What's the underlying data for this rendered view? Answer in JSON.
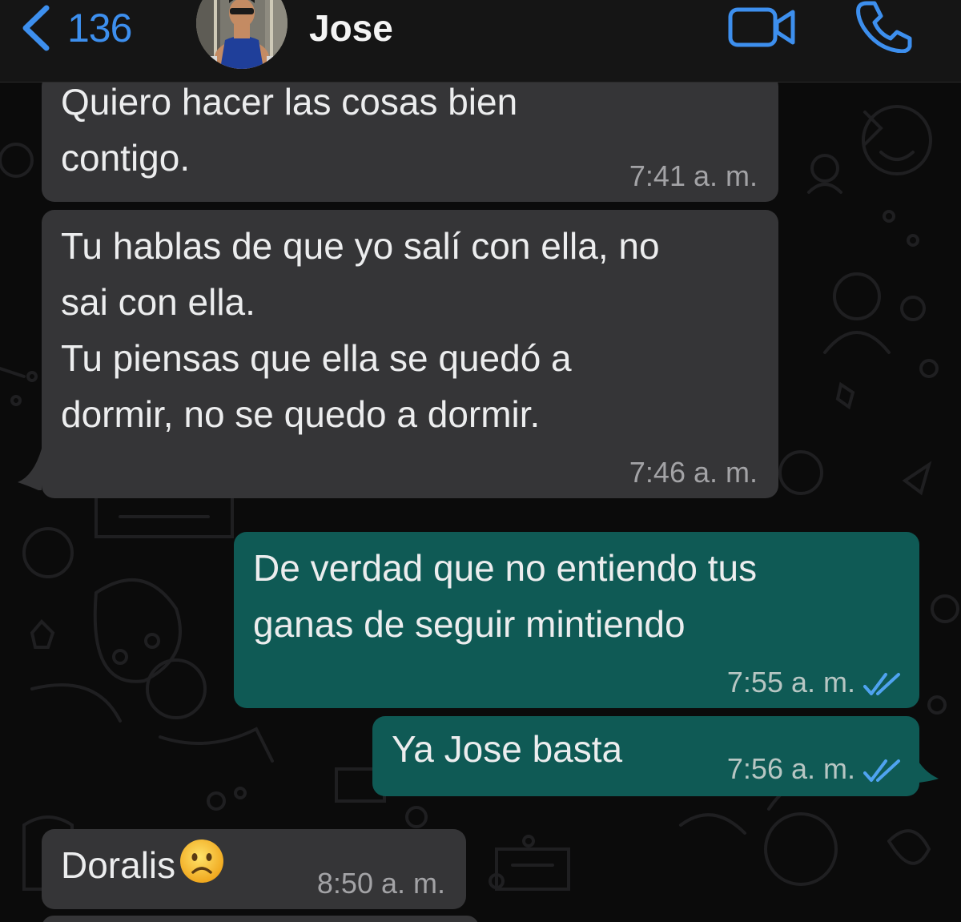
{
  "header": {
    "back_count": "136",
    "contact_name": "Jose",
    "icons": {
      "back": "chevron-left-icon",
      "video": "video-camera-icon",
      "call": "phone-icon"
    },
    "accent_color": "#3d8fee"
  },
  "messages": [
    {
      "direction": "incoming",
      "text": "Quiero hacer las cosas bien\ncontigo.",
      "time": "7:41 a. m."
    },
    {
      "direction": "incoming",
      "text": "Tu hablas de que yo salí con ella, no\nsai con ella.\nTu piensas que ella se quedó a\ndormir, no se quedo a dormir.",
      "time": "7:46 a. m."
    },
    {
      "direction": "outgoing",
      "text": "De verdad que no entiendo tus\nganas de seguir mintiendo",
      "time": "7:55 a. m.",
      "status": "read"
    },
    {
      "direction": "outgoing",
      "text": "Ya Jose basta",
      "time": "7:56 a. m.",
      "status": "read"
    },
    {
      "direction": "incoming",
      "text": "Doralis",
      "emoji": "sad-face-emoji",
      "time": "8:50 a. m."
    }
  ],
  "colors": {
    "incoming_bubble": "#353537",
    "outgoing_bubble": "#0f5a55",
    "read_ticks": "#4fa3f0",
    "background": "#0b0b0b"
  }
}
